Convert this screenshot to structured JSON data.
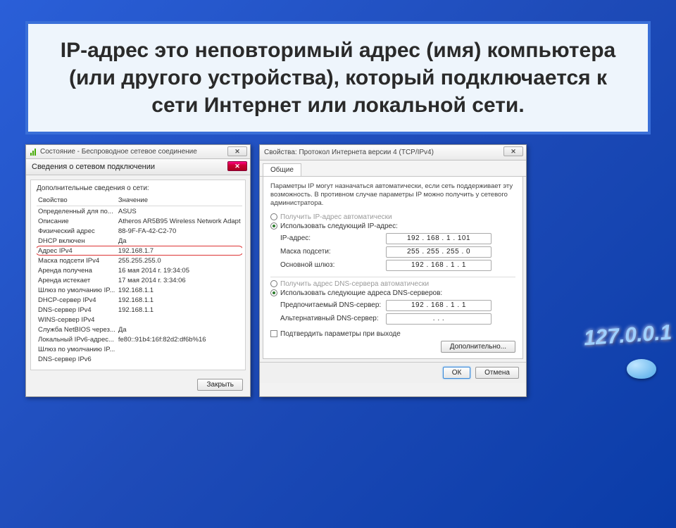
{
  "title": "IP-адрес это неповторимый адрес (имя) компьютера (или другого устройства), который подключается к сети Интернет или локальной сети.",
  "deco_ip": "127.0.0.1",
  "left_window": {
    "outer_title": "Состояние - Беспроводное сетевое соединение",
    "inner_title": "Сведения о сетевом подключении",
    "panel_label": "Дополнительные сведения о сети:",
    "col1": "Свойство",
    "col2": "Значение",
    "rows": [
      {
        "k": "Определенный для по...",
        "v": "ASUS"
      },
      {
        "k": "Описание",
        "v": "Atheros AR5B95 Wireless Network Adapt"
      },
      {
        "k": "Физический адрес",
        "v": "88-9F-FA-42-C2-70"
      },
      {
        "k": "DHCP включен",
        "v": "Да"
      },
      {
        "k": "Адрес IPv4",
        "v": "192.168.1.7",
        "hl": true
      },
      {
        "k": "Маска подсети IPv4",
        "v": "255.255.255.0"
      },
      {
        "k": "Аренда получена",
        "v": "16 мая 2014 г. 19:34:05"
      },
      {
        "k": "Аренда истекает",
        "v": "17 мая 2014 г. 3:34:06"
      },
      {
        "k": "Шлюз по умолчанию IP...",
        "v": "192.168.1.1"
      },
      {
        "k": "DHCP-сервер IPv4",
        "v": "192.168.1.1"
      },
      {
        "k": "DNS-сервер IPv4",
        "v": "192.168.1.1"
      },
      {
        "k": "WINS-сервер IPv4",
        "v": ""
      },
      {
        "k": "Служба NetBIOS через...",
        "v": "Да"
      },
      {
        "k": "Локальный IPv6-адрес...",
        "v": "fe80::91b4:16f:82d2:df6b%16"
      },
      {
        "k": "Шлюз по умолчанию IP...",
        "v": ""
      },
      {
        "k": "DNS-сервер IPv6",
        "v": ""
      }
    ],
    "close_btn": "Закрыть"
  },
  "right_window": {
    "title": "Свойства: Протокол Интернета версии 4 (TCP/IPv4)",
    "tab": "Общие",
    "desc": "Параметры IP могут назначаться автоматически, если сеть поддерживает эту возможность. В противном случае параметры IP можно получить у сетевого администратора.",
    "radio_auto_ip": "Получить IP-адрес автоматически",
    "radio_manual_ip": "Использовать следующий IP-адрес:",
    "fields_ip": {
      "ip_label": "IP-адрес:",
      "ip_value": "192 . 168 .  1  . 101",
      "mask_label": "Маска подсети:",
      "mask_value": "255 . 255 . 255 .  0",
      "gw_label": "Основной шлюз:",
      "gw_value": "192 . 168 .  1  .  1"
    },
    "radio_auto_dns": "Получить адрес DNS-сервера автоматически",
    "radio_manual_dns": "Использовать следующие адреса DNS-серверов:",
    "fields_dns": {
      "dns1_label": "Предпочитаемый DNS-сервер:",
      "dns1_value": "192 . 168 .  1  .  1",
      "dns2_label": "Альтернативный DNS-сервер:",
      "dns2_value": ".       .       ."
    },
    "checkbox": "Подтвердить параметры при выходе",
    "advanced_btn": "Дополнительно...",
    "ok_btn": "ОК",
    "cancel_btn": "Отмена"
  }
}
